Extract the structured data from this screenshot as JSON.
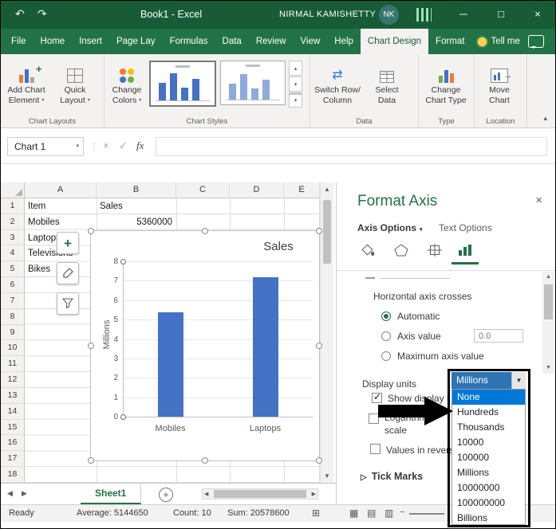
{
  "titlebar": {
    "title": "Book1 - Excel",
    "user_name": "NIRMAL KAMISHETTY",
    "avatar_initials": "NK"
  },
  "tabs": {
    "items": [
      {
        "label": "File",
        "active": false
      },
      {
        "label": "Home",
        "active": false
      },
      {
        "label": "Insert",
        "active": false
      },
      {
        "label": "Page Lay",
        "active": false
      },
      {
        "label": "Formulas",
        "active": false
      },
      {
        "label": "Data",
        "active": false
      },
      {
        "label": "Review",
        "active": false
      },
      {
        "label": "View",
        "active": false
      },
      {
        "label": "Help",
        "active": false
      },
      {
        "label": "Chart Design",
        "active": true
      },
      {
        "label": "Format",
        "active": false
      }
    ],
    "tell_me": "Tell me"
  },
  "ribbon": {
    "groups": [
      {
        "label": "Chart Layouts",
        "buttons": [
          {
            "l1": "Add Chart",
            "l2": "Element"
          },
          {
            "l1": "Quick",
            "l2": "Layout"
          }
        ]
      },
      {
        "label": "Chart Styles",
        "buttons": [
          {
            "l1": "Change",
            "l2": "Colors"
          }
        ]
      },
      {
        "label": "Data",
        "buttons": [
          {
            "l1": "Switch Row/",
            "l2": "Column"
          },
          {
            "l1": "Select",
            "l2": "Data"
          }
        ]
      },
      {
        "label": "Type",
        "buttons": [
          {
            "l1": "Change",
            "l2": "Chart Type"
          }
        ]
      },
      {
        "label": "Location",
        "buttons": [
          {
            "l1": "Move",
            "l2": "Chart"
          }
        ]
      }
    ]
  },
  "formula_bar": {
    "name_box": "Chart 1",
    "fx": "fx"
  },
  "grid": {
    "col_headers": [
      "A",
      "B",
      "C",
      "D",
      "E"
    ],
    "row_count": 18,
    "cells": [
      {
        "ref": "A1",
        "text": "Item"
      },
      {
        "ref": "B1",
        "text": "Sales"
      },
      {
        "ref": "A2",
        "text": "Mobiles"
      },
      {
        "ref": "B2",
        "text": "5360000",
        "align": "right"
      },
      {
        "ref": "A3",
        "text": "Laptops"
      },
      {
        "ref": "A4",
        "text": "Televisions"
      },
      {
        "ref": "A5",
        "text": "Bikes"
      }
    ]
  },
  "chart_data": {
    "type": "bar",
    "title": "Sales",
    "categories": [
      "Mobiles",
      "Laptops"
    ],
    "values": [
      5360000,
      7200000
    ],
    "ylabel": "Millions",
    "y_unit": 1000000,
    "y_ticks": [
      0,
      1,
      2,
      3,
      4,
      5,
      6,
      7,
      8
    ],
    "ylim": [
      0,
      8000000
    ],
    "bar_color": "#4472C4",
    "legend": "none",
    "grid": true
  },
  "format_panel": {
    "title": "Format Axis",
    "close": "×",
    "tab_axis": "Axis Options",
    "tab_text": "Text Options",
    "section": "Horizontal axis crosses",
    "radio_automatic": "Automatic",
    "radio_axis_value": "Axis value",
    "axis_value": "0.0",
    "radio_max": "Maximum axis value",
    "display_units_label": "Display units",
    "show_display_units": "Show display un",
    "logarithmic_line1": "Logarithmic",
    "logarithmic_line2": "scale",
    "values_reverse": "Values in reverse",
    "tick_marks": "Tick Marks"
  },
  "display_units_dropdown": {
    "selected": "Millions",
    "highlighted_index": 0,
    "items": [
      "None",
      "Hundreds",
      "Thousands",
      "10000",
      "100000",
      "Millions",
      "10000000",
      "100000000",
      "Billions"
    ]
  },
  "sheet_tabs": {
    "active": "Sheet1"
  },
  "status_bar": {
    "mode": "Ready",
    "average": "Average: 5144650",
    "count": "Count: 10",
    "sum": "Sum: 20578600"
  },
  "colors": {
    "titlebar_green": "#185C37",
    "ribbon_green": "#217346",
    "bar_blue": "#4472C4",
    "comb_blue": "#2E74B5",
    "list_highlight": "#0078D7"
  }
}
